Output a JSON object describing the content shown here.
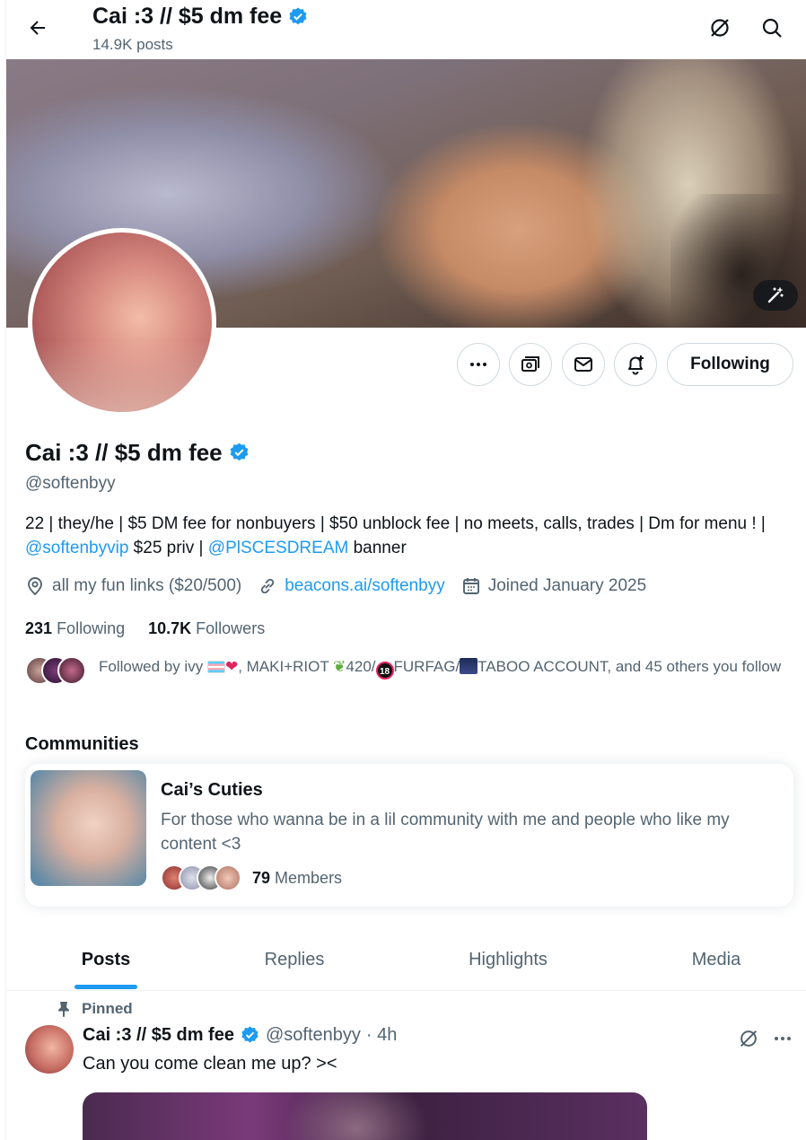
{
  "header": {
    "name": "Cai :3 // $5 dm fee",
    "posts": "14.9K posts"
  },
  "profile": {
    "name": "Cai :3 // $5 dm fee",
    "handle": "@softenbyy",
    "bio": {
      "part1": "22 | they/he | $5 DM fee for nonbuyers | $50 unblock fee | no meets, calls, trades | Dm for menu ! | ",
      "mention1": "@softenbyvip",
      "part2": " $25 priv | ",
      "mention2": "@PlSCESDREAM",
      "part3": " banner"
    },
    "location": "all my fun links ($20/500)",
    "website": "beacons.ai/softenbyy",
    "joined": "Joined January 2025",
    "following_count": "231",
    "following_label": "Following",
    "followers_count": "10.7K",
    "followers_label": "Followers",
    "followed_by": {
      "prefix": "Followed by ivy ",
      "after_flag_heart": ", MAKI+RIOT ",
      "item_420": "420/",
      "item_furfag": "FURFAG/",
      "item_taboo": "TABOO ACCOUNT, and 45 others you follow"
    },
    "follow_button": "Following"
  },
  "communities": {
    "title": "Communities",
    "card": {
      "name": "Cai’s Cuties",
      "description": "For those who wanna be in a lil community with me and people who like my content <3",
      "members_count": "79",
      "members_label": "Members"
    }
  },
  "tabs": [
    {
      "label": "Posts"
    },
    {
      "label": "Replies"
    },
    {
      "label": "Highlights"
    },
    {
      "label": "Media"
    }
  ],
  "post": {
    "pinned_label": "Pinned",
    "name": "Cai :3 // $5 dm fee",
    "handle": "@softenbyy",
    "time": "· 4h",
    "text": "Can you come clean me up? ><"
  },
  "colors": {
    "accent": "#1d9bf0",
    "text": "#0f1419",
    "muted": "#536471",
    "border": "#cfd9de"
  },
  "icons": [
    "back-arrow-icon",
    "grok-icon",
    "search-icon",
    "magic-wand-icon",
    "more-icon",
    "subscription-icon",
    "message-icon",
    "notification-bell-icon",
    "location-icon",
    "link-icon",
    "calendar-icon",
    "verified-badge-icon",
    "pin-icon"
  ]
}
